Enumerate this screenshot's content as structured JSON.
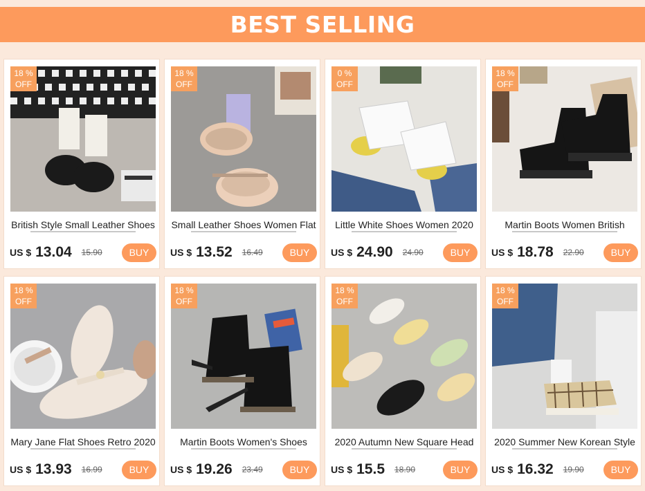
{
  "banner": {
    "title": "BEST SELLING"
  },
  "colors": {
    "accent": "#fd9a5c",
    "badge": "#f7a05e",
    "background": "#fbe9dc"
  },
  "products": [
    {
      "discount": "18 %",
      "off": "OFF",
      "title": "British Style Small Leather Shoes",
      "currency": "US $",
      "price": "13.04",
      "old_price": "15.90",
      "buy": "BUY"
    },
    {
      "discount": "18 %",
      "off": "OFF",
      "title": "Small Leather Shoes Women Flat",
      "currency": "US $",
      "price": "13.52",
      "old_price": "16.49",
      "buy": "BUY"
    },
    {
      "discount": "0 %",
      "off": "OFF",
      "title": "Little White Shoes Women 2020",
      "currency": "US $",
      "price": "24.90",
      "old_price": "24.90",
      "buy": "BUY"
    },
    {
      "discount": "18 %",
      "off": "OFF",
      "title": "Martin Boots Women British",
      "currency": "US $",
      "price": "18.78",
      "old_price": "22.90",
      "buy": "BUY"
    },
    {
      "discount": "18 %",
      "off": "OFF",
      "title": "Mary Jane Flat Shoes Retro 2020",
      "currency": "US $",
      "price": "13.93",
      "old_price": "16.99",
      "buy": "BUY"
    },
    {
      "discount": "18 %",
      "off": "OFF",
      "title": "Martin Boots Women's Shoes",
      "currency": "US $",
      "price": "19.26",
      "old_price": "23.49",
      "buy": "BUY"
    },
    {
      "discount": "18 %",
      "off": "OFF",
      "title": "2020 Autumn New Square Head",
      "currency": "US $",
      "price": "15.5",
      "old_price": "18.90",
      "buy": "BUY"
    },
    {
      "discount": "18 %",
      "off": "OFF",
      "title": "2020 Summer New Korean Style",
      "currency": "US $",
      "price": "16.32",
      "old_price": "19.90",
      "buy": "BUY"
    }
  ]
}
